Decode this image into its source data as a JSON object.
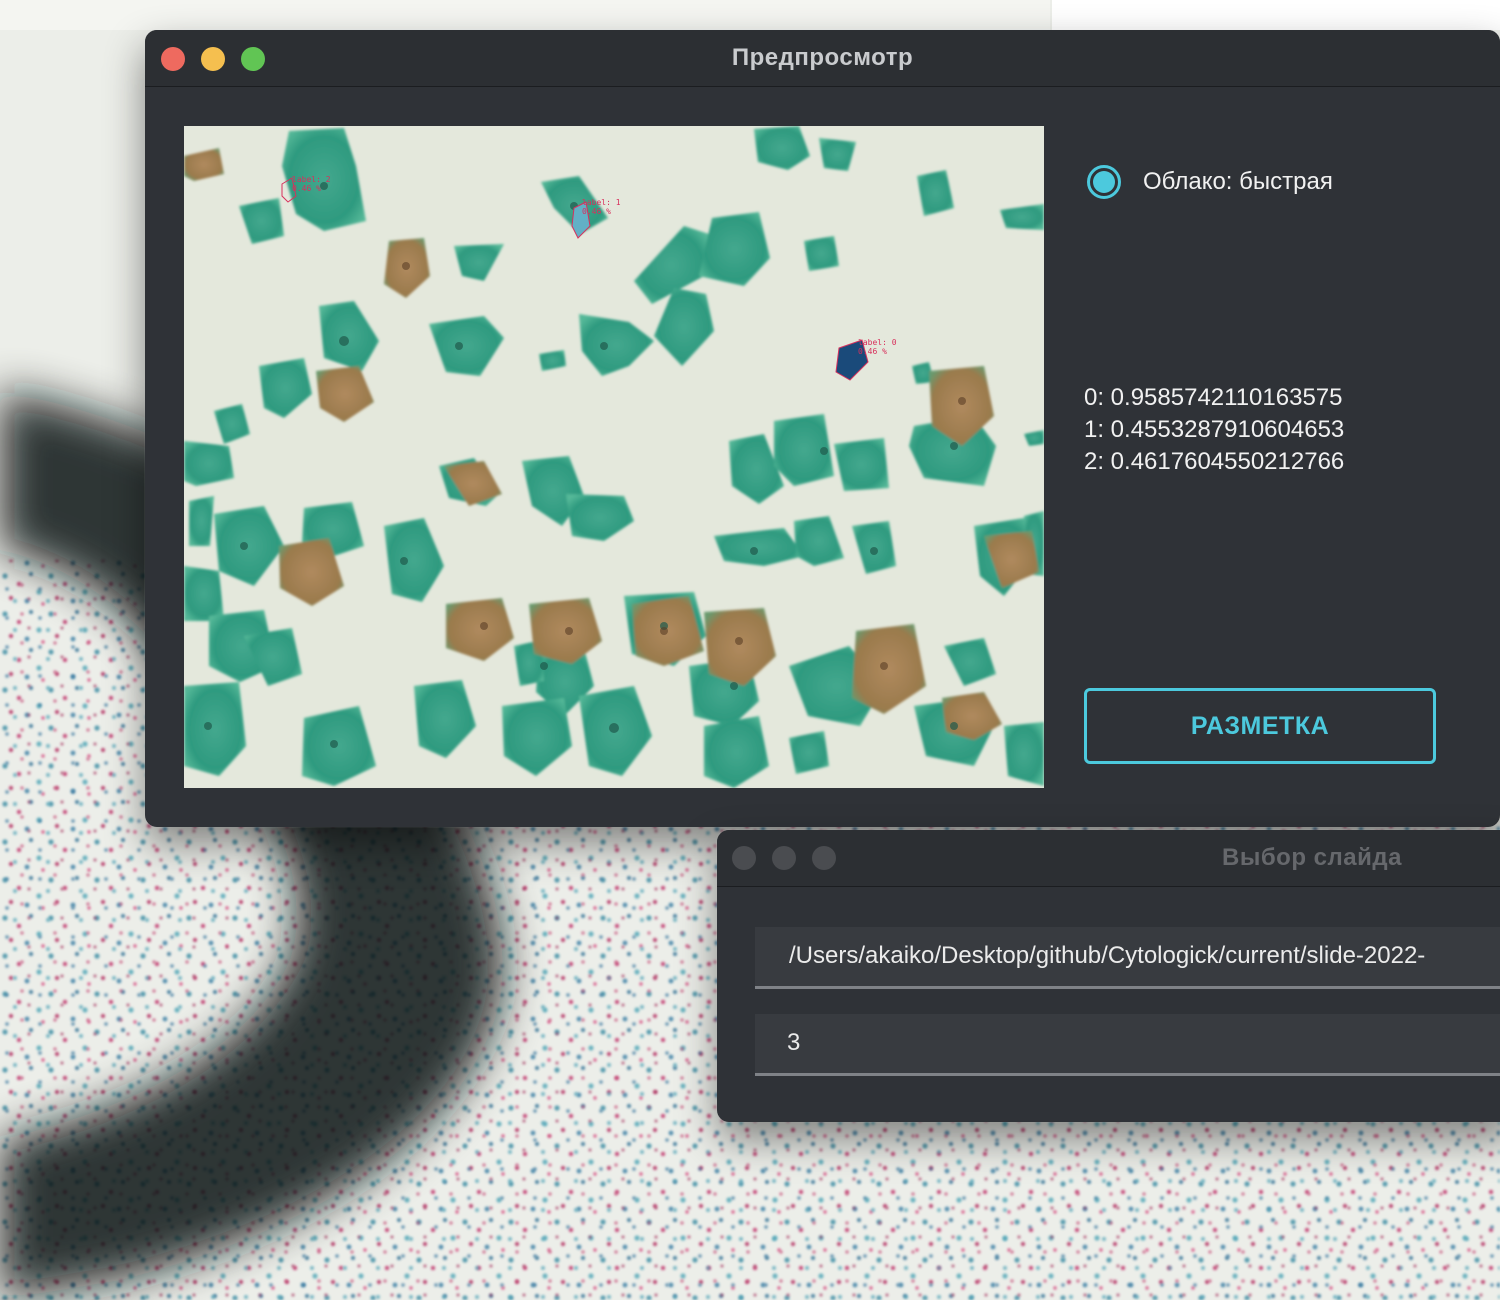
{
  "preview_window": {
    "title": "Предпросмотр",
    "radio": {
      "label": "Облако: быстрая",
      "selected": true
    },
    "scores": [
      "0: 0.9585742110163575",
      "1: 0.4553287910604653",
      "2: 0.4617604550212766"
    ],
    "markup_button": "РАЗМЕТКА",
    "detections": [
      {
        "label": "label: 2",
        "conf": "0.46 %"
      },
      {
        "label": "label: 1",
        "conf": "0.46 %"
      },
      {
        "label": "label: 0",
        "conf": "0.46 %"
      }
    ]
  },
  "slide_window": {
    "title": "Выбор слайда",
    "path_value": "/Users/akaiko/Desktop/github/Cytologick/current/slide-2022-",
    "number_value": "3"
  },
  "colors": {
    "accent": "#4cc9dd",
    "window_bg": "#2f3237",
    "traffic_close": "#ee6a5f",
    "traffic_minimize": "#f5bf4f",
    "traffic_zoom": "#61c554"
  }
}
